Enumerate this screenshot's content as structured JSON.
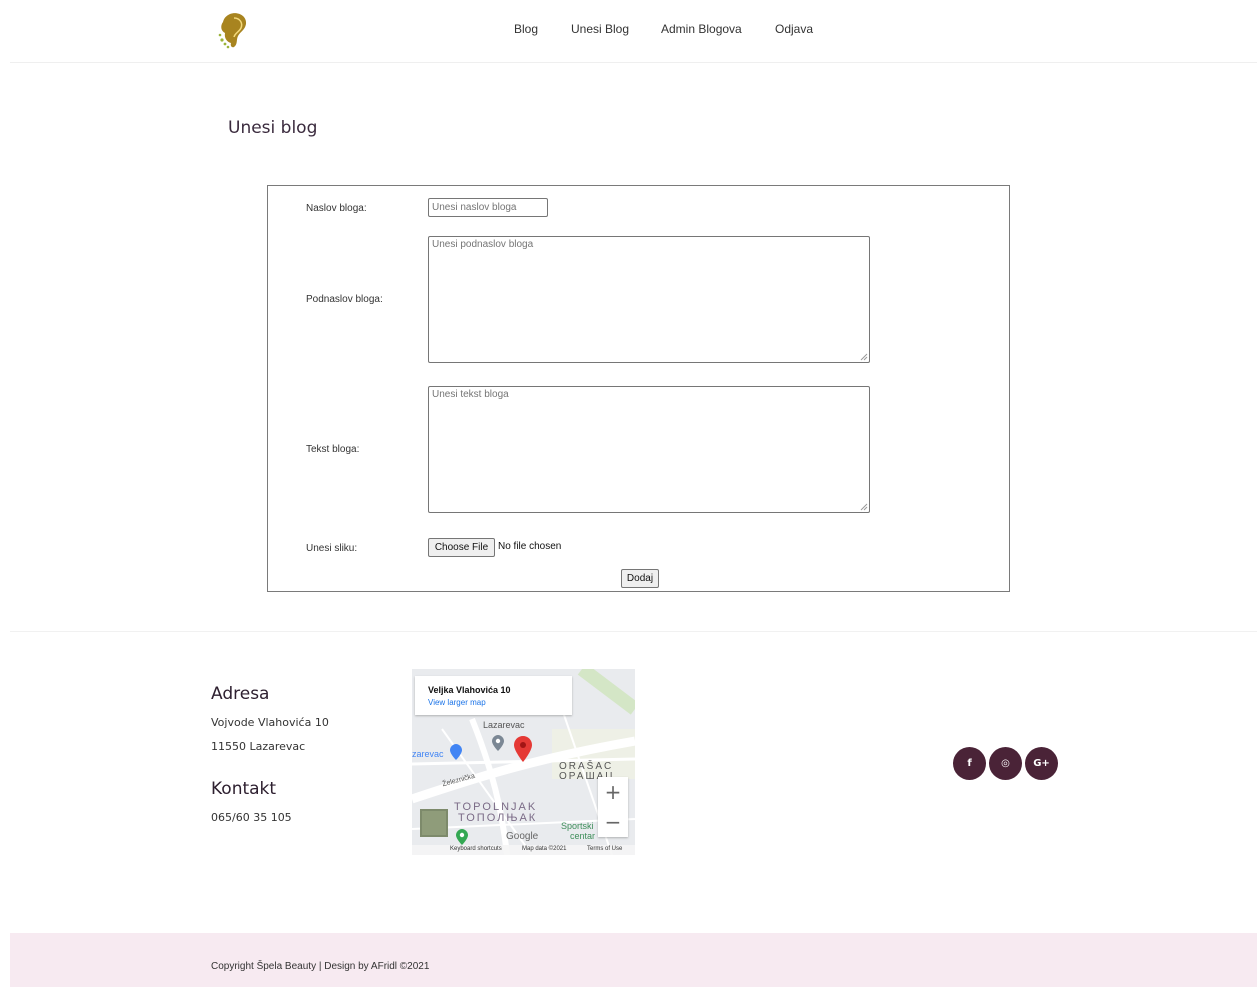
{
  "header": {
    "logo_icon": "woman-profile-logo-icon",
    "nav": [
      {
        "label": "Blog"
      },
      {
        "label": "Unesi Blog"
      },
      {
        "label": "Admin Blogova"
      },
      {
        "label": "Odjava"
      }
    ]
  },
  "page": {
    "title": "Unesi blog"
  },
  "form": {
    "title_label": "Naslov bloga:",
    "title_placeholder": "Unesi naslov bloga",
    "subtitle_label": "Podnaslov bloga:",
    "subtitle_placeholder": "Unesi podnaslov bloga",
    "text_label": "Tekst bloga:",
    "text_placeholder": "Unesi tekst bloga",
    "image_label": "Unesi sliku:",
    "file_button": "Choose File",
    "file_status": "No file chosen",
    "submit": "Dodaj"
  },
  "footer": {
    "address_heading": "Adresa",
    "address_line1": "Vojvode Vlahovića 10",
    "address_line2": "11550 Lazarevac",
    "contact_heading": "Kontakt",
    "phone": "065/60 35 105",
    "map": {
      "place": "Veljka Vlahovića 10",
      "larger_map": "View larger map",
      "labels": [
        "Lazarevac",
        "zarevac",
        "ORAŠAC",
        "ОРАШАЦ",
        "TOPOLNJAK",
        "ТОПОЛЊАК",
        "Sportski",
        "centar",
        "Železnička"
      ],
      "zoom_in": "+",
      "zoom_out": "−",
      "attribution": "Keyboard shortcuts",
      "map_data": "Map data ©2021",
      "terms": "Terms of Use",
      "google": "Google"
    },
    "social": [
      {
        "icon": "facebook-icon",
        "glyph": "f"
      },
      {
        "icon": "instagram-icon",
        "glyph": "◎"
      },
      {
        "icon": "google-plus-icon",
        "glyph": "G+"
      }
    ],
    "copyright": "Copyright Špela Beauty | Design by AFridl ©2021"
  }
}
